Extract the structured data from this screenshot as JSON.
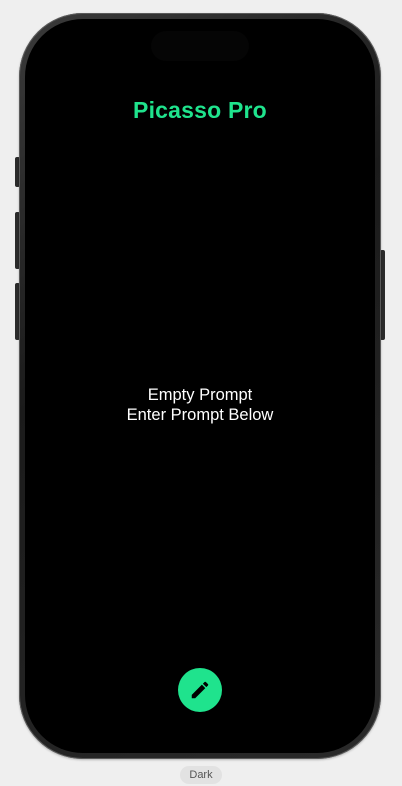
{
  "app": {
    "title": "Picasso Pro"
  },
  "empty_state": {
    "line1": "Empty Prompt",
    "line2": "Enter Prompt Below"
  },
  "fab": {
    "icon": "pencil-icon",
    "accent_color": "#1fe38d"
  },
  "preview_mode": {
    "label": "Dark"
  }
}
